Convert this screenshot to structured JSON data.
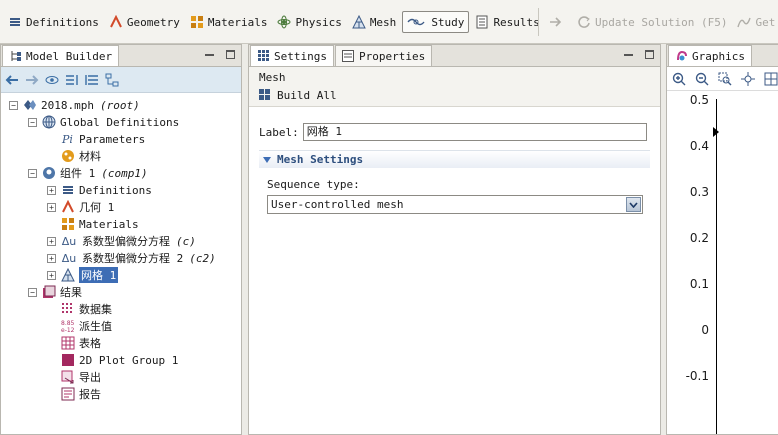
{
  "ribbon": {
    "tabs": [
      {
        "label": "Definitions",
        "icon": "definitions-icon"
      },
      {
        "label": "Geometry",
        "icon": "geometry-icon"
      },
      {
        "label": "Materials",
        "icon": "materials-icon"
      },
      {
        "label": "Physics",
        "icon": "physics-icon"
      },
      {
        "label": "Mesh",
        "icon": "mesh-icon"
      },
      {
        "label": "Study",
        "icon": "study-icon"
      },
      {
        "label": "Results",
        "icon": "results-icon"
      }
    ],
    "update_solution": "Update Solution (F5)",
    "get_initial": "Get Init"
  },
  "model_builder": {
    "title": "Model Builder",
    "tree": {
      "root": {
        "label": "2018.mph",
        "tag": "(root)"
      },
      "global_definitions": "Global Definitions",
      "parameters": "Parameters",
      "materials_global": "材料",
      "component": {
        "label": "组件 1",
        "tag": "(comp1)"
      },
      "definitions": "Definitions",
      "geometry": "几何 1",
      "materials": "Materials",
      "pde1": {
        "label": "系数型偏微分方程",
        "tag": "(c)"
      },
      "pde2": {
        "label": "系数型偏微分方程 2",
        "tag": "(c2)"
      },
      "mesh": "网格 1",
      "results": "结果",
      "datasets": "数据集",
      "derived_values": "派生值",
      "tables": "表格",
      "plot_group": "2D Plot Group 1",
      "export": "导出",
      "reports": "报告"
    }
  },
  "settings": {
    "tab_settings": "Settings",
    "tab_properties": "Properties",
    "heading": "Mesh",
    "build_all": "Build All",
    "label_caption": "Label:",
    "label_value": "网格 1",
    "section_title": "Mesh Settings",
    "sequence_label": "Sequence type:",
    "sequence_value": "User-controlled mesh"
  },
  "graphics": {
    "tab": "Graphics",
    "y_ticks": [
      "0.5",
      "0.4",
      "0.3",
      "0.2",
      "0.1",
      "0",
      "-0.1"
    ]
  }
}
